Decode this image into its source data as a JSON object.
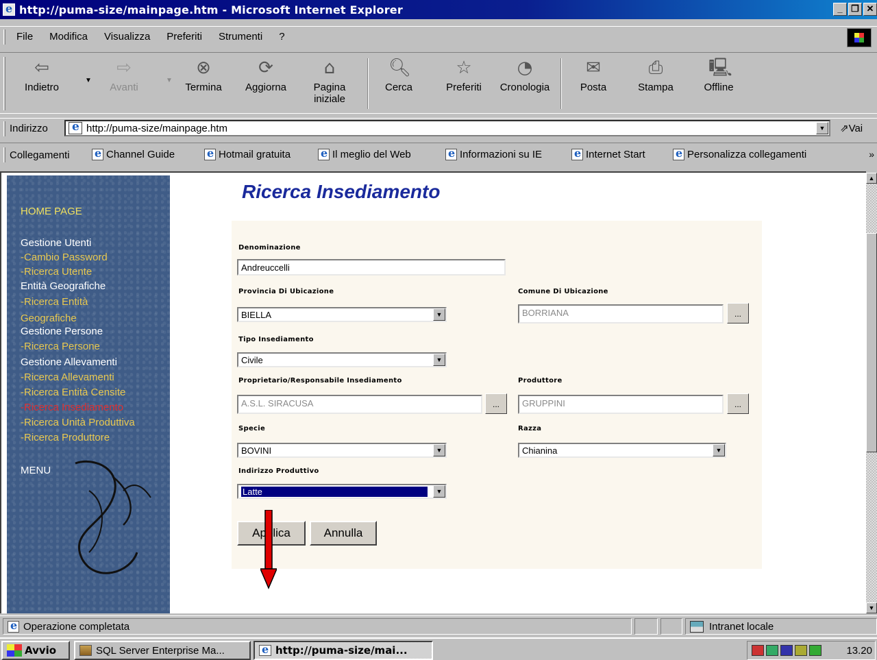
{
  "window": {
    "title": "http://puma-size/mainpage.htm - Microsoft Internet Explorer",
    "min_label": "_",
    "max_label": "❐",
    "close_label": "✕"
  },
  "menu": {
    "items": [
      {
        "label": "File",
        "key": "F"
      },
      {
        "label": "Modifica",
        "key": "M"
      },
      {
        "label": "Visualizza",
        "key": "V"
      },
      {
        "label": "Preferiti",
        "key": "P"
      },
      {
        "label": "Strumenti",
        "key": "S"
      },
      {
        "label": "?",
        "key": "?"
      }
    ]
  },
  "toolbar": {
    "back": "Indietro",
    "forward": "Avanti",
    "stop": "Termina",
    "refresh": "Aggiorna",
    "home_line1": "Pagina",
    "home_line2": "iniziale",
    "search": "Cerca",
    "favorites": "Preferiti",
    "history": "Cronologia",
    "mail": "Posta",
    "print": "Stampa",
    "offline": "Offline"
  },
  "address": {
    "label": "Indirizzo",
    "url": "http://puma-size/mainpage.htm",
    "go": "Vai"
  },
  "links": {
    "label": "Collegamenti",
    "items": [
      "Channel Guide",
      "Hotmail gratuita",
      "Il meglio del Web",
      "Informazioni su IE",
      "Internet Start",
      "Personalizza collegamenti"
    ]
  },
  "sidebar": {
    "home": "HOME PAGE",
    "gestione_utenti": "Gestione Utenti",
    "cambio_password": "-Cambio Password",
    "ricerca_utente": "-Ricerca Utente",
    "entita_geografiche": "Entità Geografiche",
    "ricerca_entita_1": "-Ricerca Entità",
    "ricerca_entita_2": "Geografiche",
    "gestione_persone": "Gestione Persone",
    "ricerca_persone": "-Ricerca Persone",
    "gestione_allevamenti": "Gestione Allevamenti",
    "ricerca_allevamenti": "-Ricerca Allevamenti",
    "ricerca_entita_censite": "-Ricerca Entità Censite",
    "ricerca_insediamento": "-Ricerca Insediamento",
    "ricerca_unita_produttiva": "-Ricerca Unità Produttiva",
    "ricerca_produttore": "-Ricerca Produttore",
    "menu": "MENU"
  },
  "form": {
    "title": "Ricerca Insediamento",
    "denominazione_label": "Denominazione",
    "denominazione_value": "Andreuccelli",
    "provincia_label": "Provincia Di Ubicazione",
    "provincia_value": "BIELLA",
    "comune_label": "Comune Di Ubicazione",
    "comune_value": "BORRIANA",
    "tipo_label": "Tipo Insediamento",
    "tipo_value": "Civile",
    "proprietario_label": "Proprietario/Responsabile Insediamento",
    "proprietario_value": "A.S.L. SIRACUSA",
    "produttore_label": "Produttore",
    "produttore_value": "GRUPPINI",
    "specie_label": "Specie",
    "specie_value": "BOVINI",
    "razza_label": "Razza",
    "razza_value": "Chianina",
    "indirizzo_label": "Indirizzo Produttivo",
    "indirizzo_value": "Latte",
    "dots_label": "...",
    "applica": "Applica",
    "annulla": "Annulla"
  },
  "status": {
    "text": "Operazione completata",
    "zone": "Intranet locale"
  },
  "taskbar": {
    "start": "Avvio",
    "task1": "SQL Server Enterprise Ma...",
    "task2": "http://puma-size/mai...",
    "clock": "13.20"
  },
  "colors": {
    "title_blue": "#1a2a9c",
    "sidebar_bg": "#3f5c87",
    "sidebar_link": "#e8c850",
    "sidebar_active": "#e03030",
    "selection": "#000080",
    "annotation_arrow": "#e00000"
  }
}
